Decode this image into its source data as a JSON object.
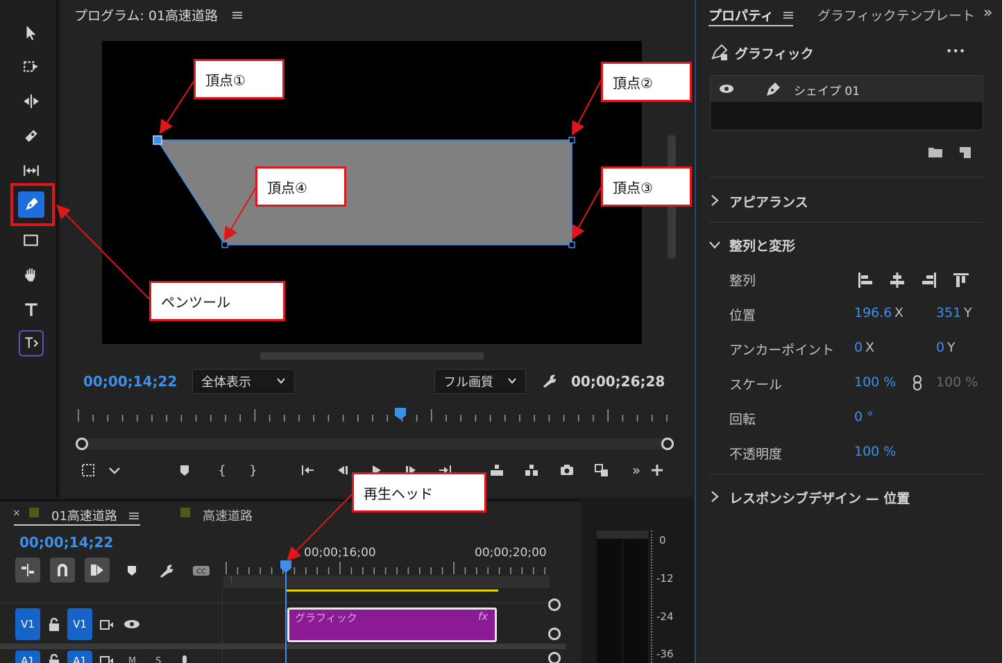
{
  "program": {
    "title": "プログラム: 01高速道路",
    "timecode_current": "00;00;14;22",
    "timecode_duration": "00;00;26;28",
    "zoom_select": "全体表示",
    "quality_select": "フル画質"
  },
  "properties": {
    "tab_properties": "プロパティ",
    "tab_graphic_template": "グラフィックテンプレート",
    "graphic_title": "グラフィック",
    "more": "•••",
    "layer_name": "シェイプ 01",
    "section_appearance": "アピアランス",
    "section_align_transform": "整列と変形",
    "align_label": "整列",
    "position_label": "位置",
    "position_x": "196.6",
    "position_y": "351",
    "anchor_label": "アンカーポイント",
    "anchor_x": "0",
    "anchor_y": "0",
    "scale_label": "スケール",
    "scale_value": "100 %",
    "scale_value_2": "100 %",
    "rotation_label": "回転",
    "rotation_value": "0 °",
    "opacity_label": "不透明度",
    "opacity_value": "100 %",
    "section_responsive": "レスポンシブデザイン — 位置",
    "x_suffix": "X",
    "y_suffix": "Y"
  },
  "timeline": {
    "tab_active": "01高速道路",
    "tab_other": "高速道路",
    "timecode": "00;00;14;22",
    "ruler_label_1": "00;00;16;00",
    "ruler_label_2": "00;00;20;00",
    "track_v1_a": "V1",
    "track_v1_b": "V1",
    "track_a1_a": "A1",
    "track_a1_b": "A1",
    "clip_name": "グラフィック",
    "clip_fx": "fx",
    "track_m": "M",
    "track_s": "S"
  },
  "meter": {
    "labels": [
      "0",
      "-12",
      "-24",
      "-36"
    ]
  },
  "annotations": {
    "vertex1": "頂点①",
    "vertex2": "頂点②",
    "vertex3": "頂点③",
    "vertex4": "頂点④",
    "pen_tool": "ペンツール",
    "playhead": "再生ヘッド"
  },
  "colors": {
    "accent_blue": "#3d8fe8",
    "clip_purple": "#8a1b95",
    "callout_red": "#e0161c",
    "shape_fill": "#808080"
  }
}
